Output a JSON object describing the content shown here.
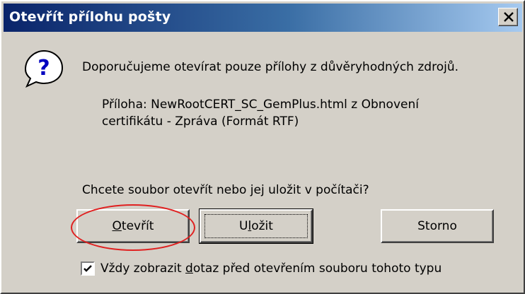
{
  "window": {
    "title": "Otevřít přílohu pošty",
    "close_symbol": "✕"
  },
  "message": {
    "icon": "question-icon",
    "text": "Doporučujeme otevírat pouze přílohy z důvěryhodných zdrojů.",
    "attachment_line1": "Příloha: NewRootCERT_SC_GemPlus.html z Obnovení",
    "attachment_line2": "certifikátu - Zpráva (Formát RTF)",
    "question": "Chcete soubor otevřít nebo jej uložit v počítači?"
  },
  "buttons": {
    "open_label_mnemonic": "O",
    "open_label_rest": "tevřít",
    "save_label_pre": "U",
    "save_label_mnemonic": "l",
    "save_label_rest": "ožit",
    "cancel_label": "Storno"
  },
  "checkbox": {
    "checked": true,
    "label_pre": "Vždy zobrazit ",
    "label_mnemonic": "d",
    "label_rest": "otaz před otevřením souboru tohoto typu"
  },
  "colors": {
    "title_gradient_start": "#0a246a",
    "title_gradient_end": "#a6caf0",
    "dialog_bg": "#d4d0c8",
    "highlight": "#e02020"
  }
}
